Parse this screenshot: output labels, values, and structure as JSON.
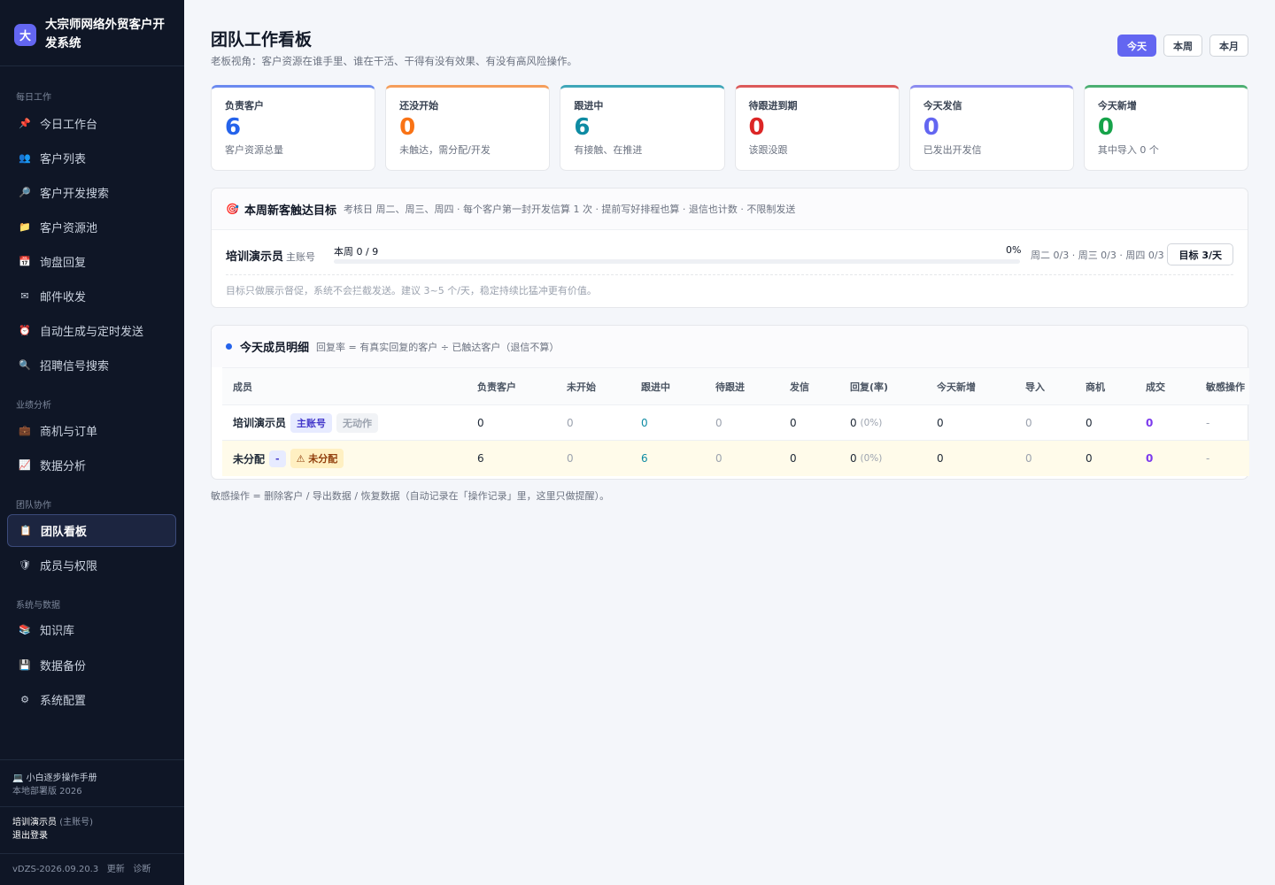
{
  "sidebar": {
    "logo_char": "大",
    "title": "大宗师网络外贸客户开发系统",
    "sections": [
      {
        "label": "每日工作",
        "items": [
          {
            "icon": "pin-icon",
            "glyph": "📌",
            "label": "今日工作台"
          },
          {
            "icon": "users-icon",
            "glyph": "👥",
            "label": "客户列表"
          },
          {
            "icon": "search-icon",
            "glyph": "🔎",
            "label": "客户开发搜索"
          },
          {
            "icon": "folder-icon",
            "glyph": "📁",
            "label": "客户资源池"
          },
          {
            "icon": "calendar-icon",
            "glyph": "📅",
            "label": "询盘回复"
          },
          {
            "icon": "mail-icon",
            "glyph": "✉",
            "label": "邮件收发"
          },
          {
            "icon": "alarm-icon",
            "glyph": "⏰",
            "label": "自动生成与定时发送"
          },
          {
            "icon": "magnifier-icon",
            "glyph": "🔍",
            "label": "招聘信号搜索"
          }
        ]
      },
      {
        "label": "业绩分析",
        "items": [
          {
            "icon": "briefcase-icon",
            "glyph": "💼",
            "label": "商机与订单"
          },
          {
            "icon": "chart-icon",
            "glyph": "📈",
            "label": "数据分析"
          }
        ]
      },
      {
        "label": "团队协作",
        "items": [
          {
            "icon": "clipboard-icon",
            "glyph": "📋",
            "label": "团队看板",
            "active": true
          },
          {
            "icon": "shield-icon",
            "glyph": "🛡",
            "label": "成员与权限"
          }
        ]
      },
      {
        "label": "系统与数据",
        "items": [
          {
            "icon": "books-icon",
            "glyph": "📚",
            "label": "知识库"
          },
          {
            "icon": "disk-icon",
            "glyph": "💾",
            "label": "数据备份"
          },
          {
            "icon": "gear-icon",
            "glyph": "⚙",
            "label": "系统配置"
          }
        ]
      }
    ],
    "manual": "💻 小白逐步操作手册",
    "deploy": "本地部署版 2026",
    "user_name": "培训演示员",
    "user_role": "(主账号)",
    "logout": "退出登录",
    "version": "vDZS-2026.09.20.3",
    "update": "更新",
    "diagnose": "诊断"
  },
  "header": {
    "title": "团队工作看板",
    "subtitle": "老板视角：客户资源在谁手里、谁在干活、干得有没有效果、有没有高风险操作。",
    "ranges": [
      "今天",
      "本周",
      "本月"
    ],
    "active_range": "今天"
  },
  "kpis": [
    {
      "label": "负责客户",
      "value": "6",
      "note": "客户资源总量",
      "color": "#2563eb",
      "bar": "#6b8af0"
    },
    {
      "label": "还没开始",
      "value": "0",
      "note": "未触达，需分配/开发",
      "color": "#f97316",
      "bar": "#f59e5b"
    },
    {
      "label": "跟进中",
      "value": "6",
      "note": "有接触、在推进",
      "color": "#0e8ba3",
      "bar": "#3fa6b8"
    },
    {
      "label": "待跟进到期",
      "value": "0",
      "note": "该跟没跟",
      "color": "#dc2626",
      "bar": "#dc5a5a"
    },
    {
      "label": "今天发信",
      "value": "0",
      "note": "已发出开发信",
      "color": "#6366f1",
      "bar": "#8b8cf0"
    },
    {
      "label": "今天新增",
      "value": "0",
      "note": "其中导入 0 个",
      "color": "#16a34a",
      "bar": "#4caf72"
    }
  ],
  "goal": {
    "icon": "🎯",
    "title": "本周新客触达目标",
    "desc": "考核日 周二、周三、周四 · 每个客户第一封开发信算 1 次 · 提前写好排程也算 · 退信也计数 · 不限制发送",
    "member": "培训演示员",
    "member_role": "主账号",
    "week": "本周 0 / 9",
    "pct": "0%",
    "progress": 0,
    "days": "周二 0/3 · 周三 0/3 · 周四 0/3",
    "target_btn": "目标 3/天",
    "tip": "目标只做展示督促，系统不会拦截发送。建议 3~5 个/天，稳定持续比猛冲更有价值。"
  },
  "members": {
    "title": "今天成员明细",
    "desc": "回复率 = 有真实回复的客户 ÷ 已触达客户（退信不算）",
    "columns": [
      "成员",
      "负责客户",
      "未开始",
      "跟进中",
      "待跟进",
      "发信",
      "回复(率)",
      "今天新增",
      "导入",
      "商机",
      "成交",
      "敏感操作"
    ],
    "rows": [
      {
        "name": "培训演示员",
        "tag1": "主账号",
        "tag2": "无动作",
        "owned": "0",
        "not_started": "0",
        "following": "0",
        "pending": "0",
        "sent": "0",
        "reply": "0",
        "reply_rate": "(0%)",
        "new_today": "0",
        "imported": "0",
        "opps": "0",
        "deals": "0",
        "sensitive": "-"
      },
      {
        "name": "未分配",
        "tag1": "-",
        "tag2": "⚠ 未分配",
        "owned": "6",
        "not_started": "0",
        "following": "6",
        "pending": "0",
        "sent": "0",
        "reply": "0",
        "reply_rate": "(0%)",
        "new_today": "0",
        "imported": "0",
        "opps": "0",
        "deals": "0",
        "sensitive": "-"
      }
    ]
  },
  "footnote": "敏感操作 = 删除客户 / 导出数据 / 恢复数据（自动记录在「操作记录」里，这里只做提醒）。"
}
